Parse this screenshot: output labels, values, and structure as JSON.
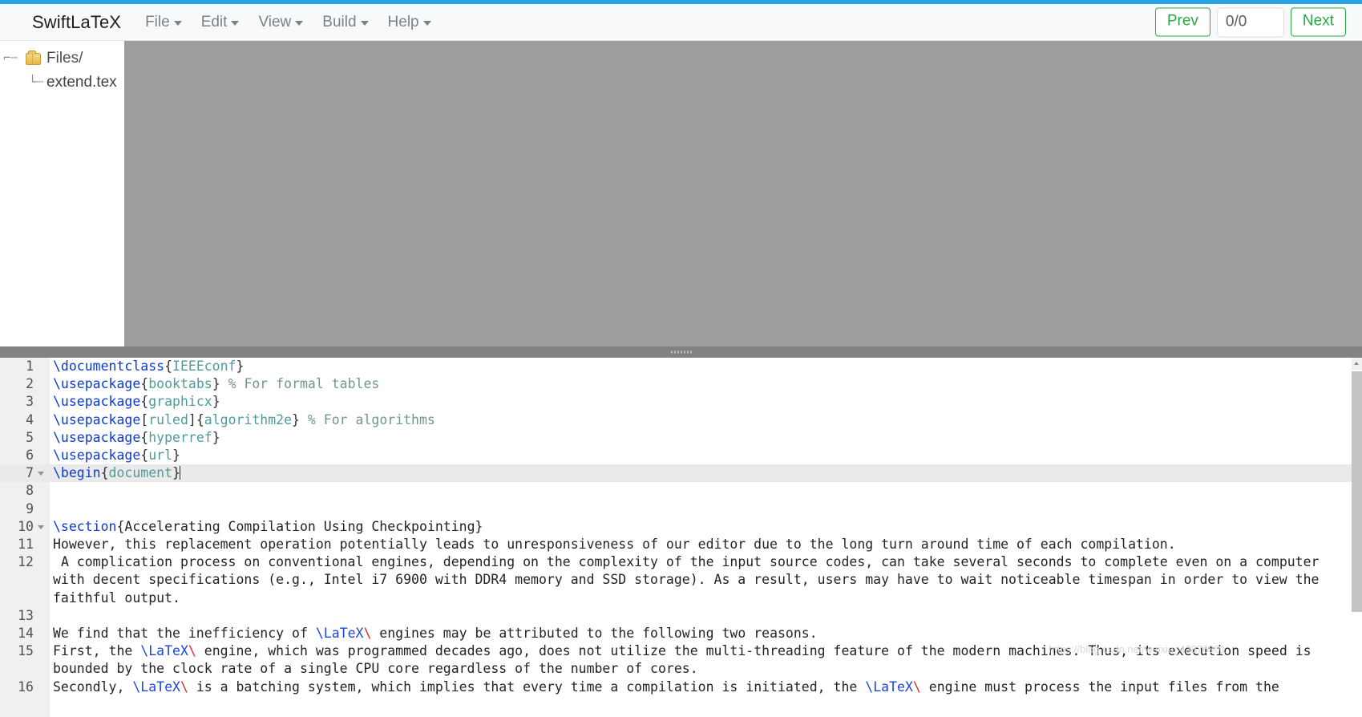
{
  "app": {
    "brand": "SwiftLaTeX",
    "accent_color": "#29a3e3",
    "button_green": "#2aa745"
  },
  "menubar": {
    "items": [
      {
        "label": "File"
      },
      {
        "label": "Edit"
      },
      {
        "label": "View"
      },
      {
        "label": "Build"
      },
      {
        "label": "Help"
      }
    ]
  },
  "nav": {
    "prev_label": "Prev",
    "page_value": "0/0",
    "page_placeholder": "0/0",
    "next_label": "Next"
  },
  "sidebar": {
    "tree": [
      {
        "label": "Files/",
        "glyph": "⌐…",
        "icon": "folder-icon"
      },
      {
        "label": "extend.tex",
        "glyph": "└┈",
        "icon": "file-none"
      }
    ]
  },
  "editor": {
    "active_line": 7,
    "lines": [
      {
        "n": "1",
        "fold": false,
        "tokens": [
          {
            "t": "\\documentclass",
            "c": "cmd"
          },
          {
            "t": "{",
            "c": "brc"
          },
          {
            "t": "IEEEconf",
            "c": "arg"
          },
          {
            "t": "}",
            "c": "brc"
          }
        ]
      },
      {
        "n": "2",
        "fold": false,
        "tokens": [
          {
            "t": "\\usepackage",
            "c": "cmd"
          },
          {
            "t": "{",
            "c": "brc"
          },
          {
            "t": "booktabs",
            "c": "arg"
          },
          {
            "t": "}",
            "c": "brc"
          },
          {
            "t": " % For formal tables",
            "c": "cmt"
          }
        ]
      },
      {
        "n": "3",
        "fold": false,
        "tokens": [
          {
            "t": "\\usepackage",
            "c": "cmd"
          },
          {
            "t": "{",
            "c": "brc"
          },
          {
            "t": "graphicx",
            "c": "arg"
          },
          {
            "t": "}",
            "c": "brc"
          }
        ]
      },
      {
        "n": "4",
        "fold": false,
        "tokens": [
          {
            "t": "\\usepackage",
            "c": "cmd"
          },
          {
            "t": "[",
            "c": "brc"
          },
          {
            "t": "ruled",
            "c": "opt"
          },
          {
            "t": "]",
            "c": "brc"
          },
          {
            "t": "{",
            "c": "brc"
          },
          {
            "t": "algorithm2e",
            "c": "arg"
          },
          {
            "t": "}",
            "c": "brc"
          },
          {
            "t": " % For algorithms",
            "c": "cmt"
          }
        ]
      },
      {
        "n": "5",
        "fold": false,
        "tokens": [
          {
            "t": "\\usepackage",
            "c": "cmd"
          },
          {
            "t": "{",
            "c": "brc"
          },
          {
            "t": "hyperref",
            "c": "arg"
          },
          {
            "t": "}",
            "c": "brc"
          }
        ]
      },
      {
        "n": "6",
        "fold": false,
        "tokens": [
          {
            "t": "\\usepackage",
            "c": "cmd"
          },
          {
            "t": "{",
            "c": "brc"
          },
          {
            "t": "url",
            "c": "arg"
          },
          {
            "t": "}",
            "c": "brc"
          }
        ]
      },
      {
        "n": "7",
        "fold": true,
        "active": true,
        "cursor": true,
        "tokens": [
          {
            "t": "\\begin",
            "c": "cmd"
          },
          {
            "t": "{",
            "c": "brc"
          },
          {
            "t": "document",
            "c": "arg"
          },
          {
            "t": "}",
            "c": "brc"
          }
        ]
      },
      {
        "n": "8",
        "fold": false,
        "tokens": []
      },
      {
        "n": "9",
        "fold": false,
        "tokens": []
      },
      {
        "n": "10",
        "fold": true,
        "tokens": [
          {
            "t": "\\section",
            "c": "cmd"
          },
          {
            "t": "{Accelerating Compilation Using Checkpointing}",
            "c": "plain"
          }
        ]
      },
      {
        "n": "11",
        "fold": false,
        "tokens": [
          {
            "t": "However, this replacement operation potentially leads to unresponsiveness of our editor due to the long turn around time of each compilation.",
            "c": "plain"
          }
        ]
      },
      {
        "n": "12",
        "fold": false,
        "tokens": [
          {
            "t": " A complication process on conventional engines, depending on the complexity of the input source codes, can take several seconds to complete even on a computer with decent specifications (e.g., Intel i7 6900 with DDR4 memory and SSD storage). As a result, users may have to wait noticeable timespan in order to view the faithful output.",
            "c": "plain"
          }
        ]
      },
      {
        "n": "13",
        "fold": false,
        "tokens": []
      },
      {
        "n": "14",
        "fold": false,
        "tokens": [
          {
            "t": "We find that the inefficiency of ",
            "c": "plain"
          },
          {
            "t": "\\LaTeX",
            "c": "ltx"
          },
          {
            "t": "\\",
            "c": "bsr"
          },
          {
            "t": " engines may be attributed to the following two reasons.",
            "c": "plain"
          }
        ]
      },
      {
        "n": "15",
        "fold": false,
        "tokens": [
          {
            "t": "First, the ",
            "c": "plain"
          },
          {
            "t": "\\LaTeX",
            "c": "ltx"
          },
          {
            "t": "\\",
            "c": "bsr"
          },
          {
            "t": " engine, which was programmed decades ago, does not utilize the multi-threading feature of the modern machines. Thus, its execution speed is bounded by the clock rate of a single CPU core regardless of the number of cores.",
            "c": "plain"
          }
        ]
      },
      {
        "n": "16",
        "fold": false,
        "tokens": [
          {
            "t": "Secondly, ",
            "c": "plain"
          },
          {
            "t": "\\LaTeX",
            "c": "ltx"
          },
          {
            "t": "\\",
            "c": "bsr"
          },
          {
            "t": " is a batching system, which implies that every time a compilation is initiated, the ",
            "c": "plain"
          },
          {
            "t": "\\LaTeX",
            "c": "ltx"
          },
          {
            "t": "\\",
            "c": "bsr"
          },
          {
            "t": " engine must process the input files from the",
            "c": "plain"
          }
        ]
      }
    ]
  },
  "watermark": {
    "text": "https://blog.csdn.net/weixin_43876801"
  }
}
